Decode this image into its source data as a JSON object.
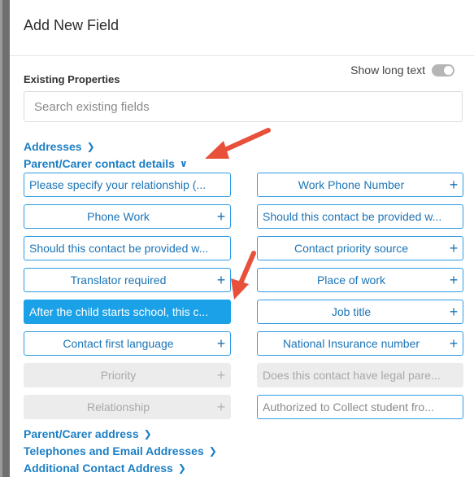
{
  "title": "Add New Field",
  "existing_label": "Existing Properties",
  "show_long_text": "Show long text",
  "search": {
    "placeholder": "Search existing fields"
  },
  "groups": {
    "addresses": "Addresses",
    "parent_carer": "Parent/Carer contact details",
    "parent_address": "Parent/Carer address",
    "telephones": "Telephones and Email Addresses",
    "additional": "Additional Contact Address"
  },
  "fields_left": [
    "Please specify your relationship (...",
    "Phone Work",
    "Should this contact be provided w...",
    "Translator required",
    "After the child starts school, this c...",
    "Contact first language",
    "Priority",
    "Relationship"
  ],
  "fields_right": [
    "Work Phone Number",
    "Should this contact be provided w...",
    "Contact priority source",
    "Place of work",
    "Job title",
    "National Insurance number",
    "Does this contact have legal pare...",
    "Authorized to Collect student fro..."
  ],
  "colors": {
    "accent": "#1aa1e8",
    "link": "#1b7fc4",
    "arrow": "#e8503a"
  }
}
